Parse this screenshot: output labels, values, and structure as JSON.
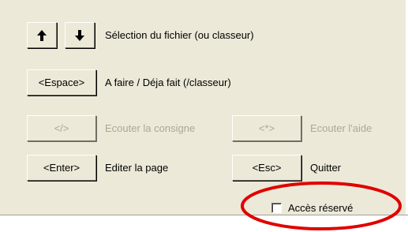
{
  "rows": {
    "file_selection": {
      "up_icon": "arrow-up-icon",
      "down_icon": "arrow-down-icon",
      "label": "Sélection du fichier (ou classeur)"
    },
    "todo": {
      "button_label": "<Espace>",
      "label": "A faire / Déja fait (/classeur)"
    },
    "listen_instruction": {
      "button_label": "</>",
      "label": "Ecouter la consigne"
    },
    "listen_help": {
      "button_label": "<*>",
      "label": "Ecouter l'aide"
    },
    "edit_page": {
      "button_label": "<Enter>",
      "label": "Editer la page"
    },
    "quit": {
      "button_label": "<Esc>",
      "label": "Quitter"
    }
  },
  "restricted_access": {
    "label": "Accès réservé",
    "checked": false
  },
  "colors": {
    "panel": "#ece9d8",
    "disabled_text": "#aca899",
    "highlight_circle": "#e00000"
  }
}
